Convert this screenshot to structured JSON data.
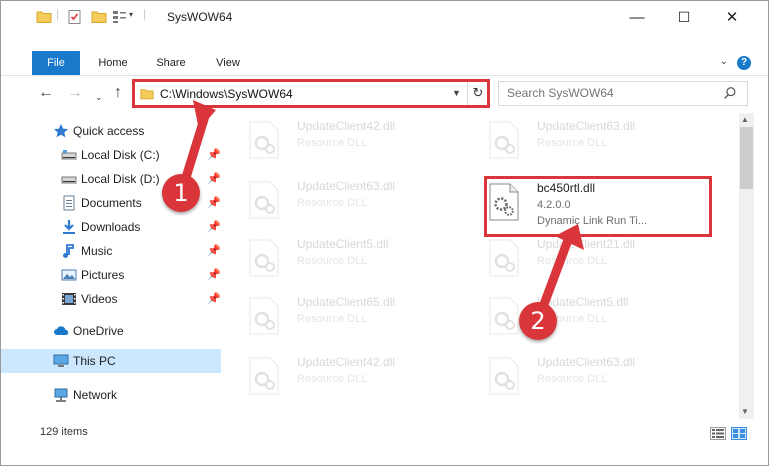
{
  "window": {
    "title": "SysWOW64",
    "controls": {
      "minimize": "—",
      "maximize": "☐",
      "close": "✕"
    }
  },
  "ribbon": {
    "tabs": [
      "File",
      "Home",
      "Share",
      "View"
    ],
    "help": "?"
  },
  "nav": {
    "address_path": "C:\\Windows\\SysWOW64",
    "search_placeholder": "Search SysWOW64"
  },
  "sidebar": {
    "items": [
      {
        "label": "Quick access",
        "icon": "star-icon",
        "pinned": false,
        "selected": false
      },
      {
        "label": "Local Disk (C:)",
        "icon": "drive-icon",
        "pinned": true,
        "selected": false
      },
      {
        "label": "Local Disk (D:)",
        "icon": "drive-icon",
        "pinned": true,
        "selected": false
      },
      {
        "label": "Documents",
        "icon": "documents-icon",
        "pinned": true,
        "selected": false
      },
      {
        "label": "Downloads",
        "icon": "download-icon",
        "pinned": true,
        "selected": false
      },
      {
        "label": "Music",
        "icon": "music-icon",
        "pinned": true,
        "selected": false
      },
      {
        "label": "Pictures",
        "icon": "pictures-icon",
        "pinned": true,
        "selected": false
      },
      {
        "label": "Videos",
        "icon": "videos-icon",
        "pinned": true,
        "selected": false
      },
      {
        "label": "OneDrive",
        "icon": "cloud-icon",
        "pinned": false,
        "selected": false
      },
      {
        "label": "This PC",
        "icon": "computer-icon",
        "pinned": false,
        "selected": true
      },
      {
        "label": "Network",
        "icon": "network-icon",
        "pinned": false,
        "selected": false
      }
    ]
  },
  "files": {
    "highlighted": {
      "name": "bc450rtl.dll",
      "version": "4.2.0.0",
      "description": "Dynamic Link Run Ti..."
    },
    "background_items": [
      {
        "name": "UpdateClient42.dll",
        "desc": "Resource DLL"
      },
      {
        "name": "UpdateClient63.dll",
        "desc": "Resource DLL"
      },
      {
        "name": "UpdateClient63.dll",
        "desc": "Resource DLL"
      },
      {
        "name": "UpdateClient5.dll",
        "desc": "Resource DLL"
      },
      {
        "name": "UpdateClient21.dll",
        "desc": "Resource DLL"
      },
      {
        "name": "UpdateClient65.dll",
        "desc": "Resource DLL"
      },
      {
        "name": "UpdateClient5.dll",
        "desc": "Resource DLL"
      },
      {
        "name": "UpdateClient42.dll",
        "desc": "Resource DLL"
      },
      {
        "name": "UpdateClient63.dll",
        "desc": "Resource DLL"
      }
    ]
  },
  "status": {
    "item_count": "129 items"
  },
  "callouts": {
    "first": "1",
    "second": "2"
  },
  "colors": {
    "accent": "#1979ca",
    "highlight": "#d9353a",
    "selection": "#cce8ff"
  }
}
